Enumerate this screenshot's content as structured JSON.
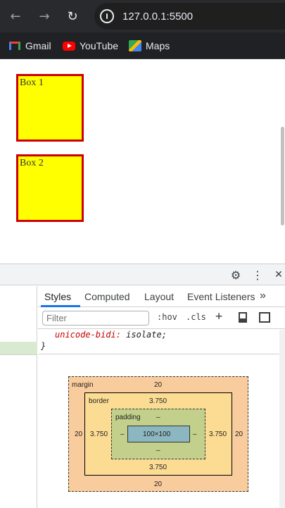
{
  "browser": {
    "url": "127.0.0.1:5500",
    "nav": {
      "back_glyph": "←",
      "forward_glyph": "→",
      "reload_glyph": "↻"
    },
    "bookmarks": [
      {
        "label": "Gmail",
        "icon": "gmail-icon"
      },
      {
        "label": "YouTube",
        "icon": "youtube-icon"
      },
      {
        "label": "Maps",
        "icon": "maps-icon"
      }
    ]
  },
  "page": {
    "boxes": [
      {
        "label": "Box 1",
        "background": "#ffff00",
        "border": "#cc0000"
      },
      {
        "label": "Box 2",
        "background": "#ffff00",
        "border": "#cc0000"
      }
    ]
  },
  "devtools": {
    "top_icons": {
      "settings": "⚙",
      "more": "⋮",
      "close": "✕"
    },
    "tabs": [
      "Styles",
      "Computed",
      "Layout",
      "Event Listeners",
      "»"
    ],
    "active_tab": "Styles",
    "filter": {
      "placeholder": "Filter",
      "hov": ":hov",
      "cls": ".cls",
      "add": "+"
    },
    "code": {
      "property": "unicode-bidi:",
      "value": "isolate;",
      "closing_brace": "}"
    },
    "box_model": {
      "margin": {
        "label": "margin",
        "top": "20",
        "right": "20",
        "bottom": "20",
        "left": "20"
      },
      "border": {
        "label": "border",
        "top": "3.750",
        "right": "3.750",
        "bottom": "3.750",
        "left": "3.750"
      },
      "padding": {
        "label": "padding",
        "top": "–",
        "right": "–",
        "bottom": "–",
        "left": "–"
      },
      "content": "100×100",
      "colors": {
        "margin": "#f9cc9d",
        "border": "#fcdc93",
        "padding": "#c3d08b",
        "content": "#8cb6c0"
      }
    }
  }
}
